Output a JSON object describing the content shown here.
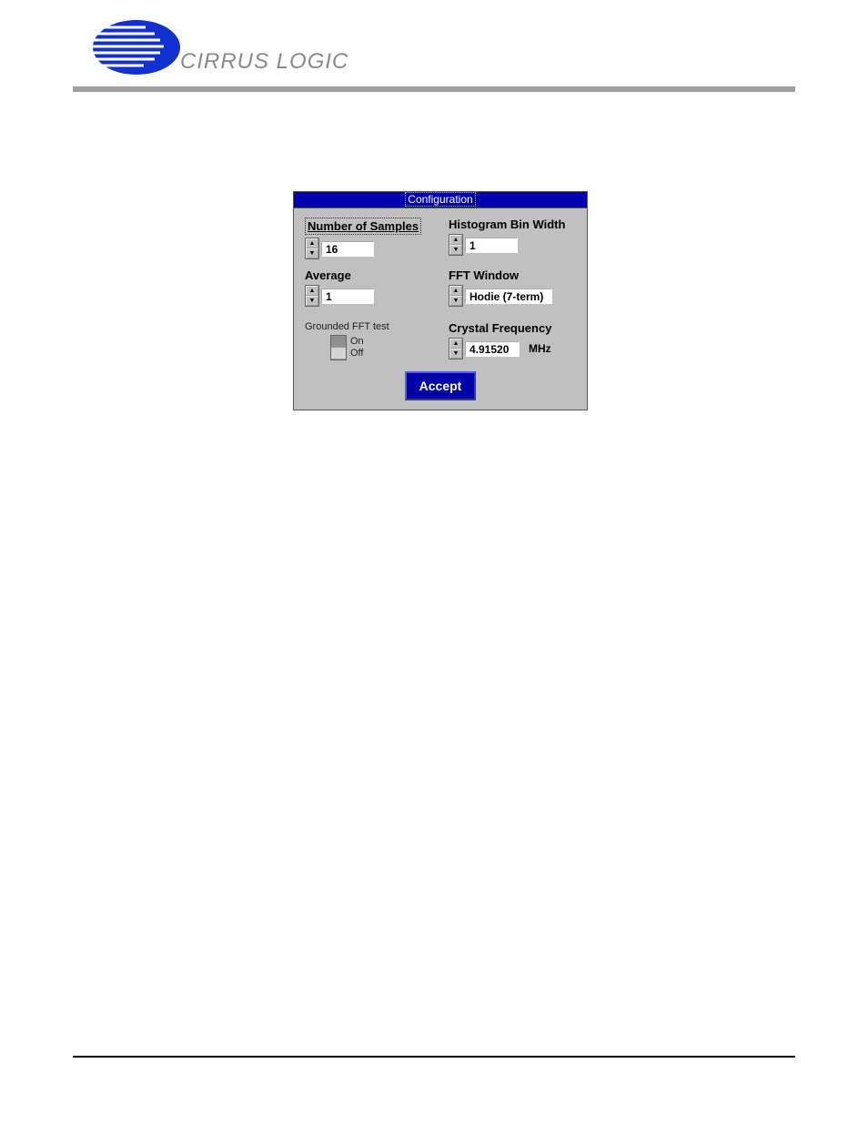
{
  "brand": "CIRRUS LOGIC",
  "window": {
    "title": "Configuration",
    "fields": {
      "num_samples": {
        "label": "Number of Samples",
        "value": "16"
      },
      "average": {
        "label": "Average",
        "value": "1"
      },
      "hist_bin": {
        "label": "Histogram Bin Width",
        "value": "1"
      },
      "fft_window": {
        "label": "FFT Window",
        "value": "Hodie (7-term)"
      },
      "crystal": {
        "label": "Crystal Frequency",
        "value": "4.91520",
        "unit": "MHz"
      },
      "gft": {
        "label": "Grounded FFT test",
        "on": "On",
        "off": "Off"
      }
    },
    "accept": "Accept"
  }
}
